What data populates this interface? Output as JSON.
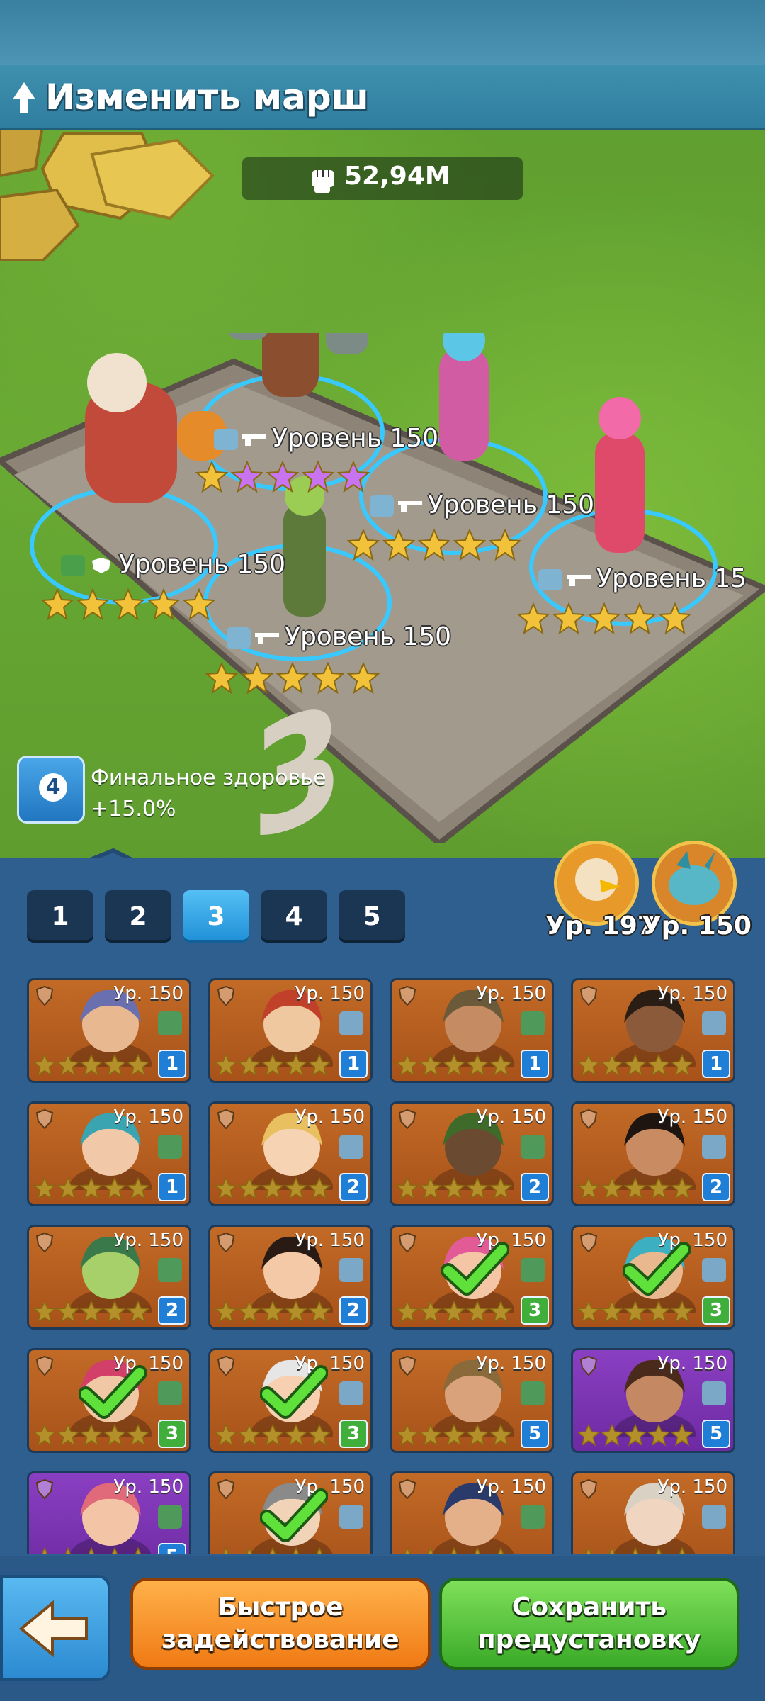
{
  "header": {
    "title": "Изменить марш",
    "power": "52,94M"
  },
  "slots": [
    {
      "level_text": "Уровень 150",
      "stars": 5
    },
    {
      "level_text": "Уровень 150",
      "stars": 5
    },
    {
      "level_text": "Уровень 150",
      "stars": 5
    },
    {
      "level_text": "Уровень 150",
      "stars": 5
    },
    {
      "level_text": "Уровень 15",
      "stars": 5
    }
  ],
  "board_number": "3",
  "bonus": {
    "badge": "4",
    "line1": "Финальное здоровье",
    "line2": "+15.0%"
  },
  "tabs": [
    "1",
    "2",
    "3",
    "4",
    "5"
  ],
  "active_tab": "3",
  "pets": [
    {
      "level": "Ур. 197"
    },
    {
      "level": "Ур. 150"
    }
  ],
  "heroes": [
    {
      "level": "Ур. 150",
      "troop": "1",
      "color": "orange",
      "selected": false
    },
    {
      "level": "Ур. 150",
      "troop": "1",
      "color": "orange",
      "selected": false
    },
    {
      "level": "Ур. 150",
      "troop": "1",
      "color": "orange",
      "selected": false
    },
    {
      "level": "Ур. 150",
      "troop": "1",
      "color": "orange",
      "selected": false
    },
    {
      "level": "Ур. 150",
      "troop": "1",
      "color": "orange",
      "selected": false
    },
    {
      "level": "Ур. 150",
      "troop": "2",
      "color": "orange",
      "selected": false
    },
    {
      "level": "Ур. 150",
      "troop": "2",
      "color": "orange",
      "selected": false
    },
    {
      "level": "Ур. 150",
      "troop": "2",
      "color": "orange",
      "selected": false
    },
    {
      "level": "Ур. 150",
      "troop": "2",
      "color": "orange",
      "selected": false
    },
    {
      "level": "Ур. 150",
      "troop": "2",
      "color": "orange",
      "selected": false
    },
    {
      "level": "Ур. 150",
      "troop": "3",
      "color": "orange",
      "selected": true
    },
    {
      "level": "Ур. 150",
      "troop": "3",
      "color": "orange",
      "selected": true
    },
    {
      "level": "Ур. 150",
      "troop": "3",
      "color": "orange",
      "selected": true
    },
    {
      "level": "Ур. 150",
      "troop": "3",
      "color": "orange",
      "selected": true
    },
    {
      "level": "Ур. 150",
      "troop": "5",
      "color": "orange",
      "selected": false
    },
    {
      "level": "Ур. 150",
      "troop": "5",
      "color": "purple",
      "selected": false
    },
    {
      "level": "Ур. 150",
      "troop": "5",
      "color": "purple",
      "selected": false
    },
    {
      "level": "Ур. 150",
      "troop": "",
      "color": "orange",
      "selected": true
    },
    {
      "level": "Ур. 150",
      "troop": "",
      "color": "orange",
      "selected": false
    },
    {
      "level": "Ур. 150",
      "troop": "",
      "color": "orange",
      "selected": false
    }
  ],
  "buttons": {
    "quick_line1": "Быстрое",
    "quick_line2": "задействование",
    "save_line1": "Сохранить",
    "save_line2": "предустановку"
  },
  "colors": {
    "panel": "#2e5f8e",
    "orange_btn": "#f07a14",
    "green_btn": "#3aaa28",
    "active_tab": "#1f8fd6"
  }
}
